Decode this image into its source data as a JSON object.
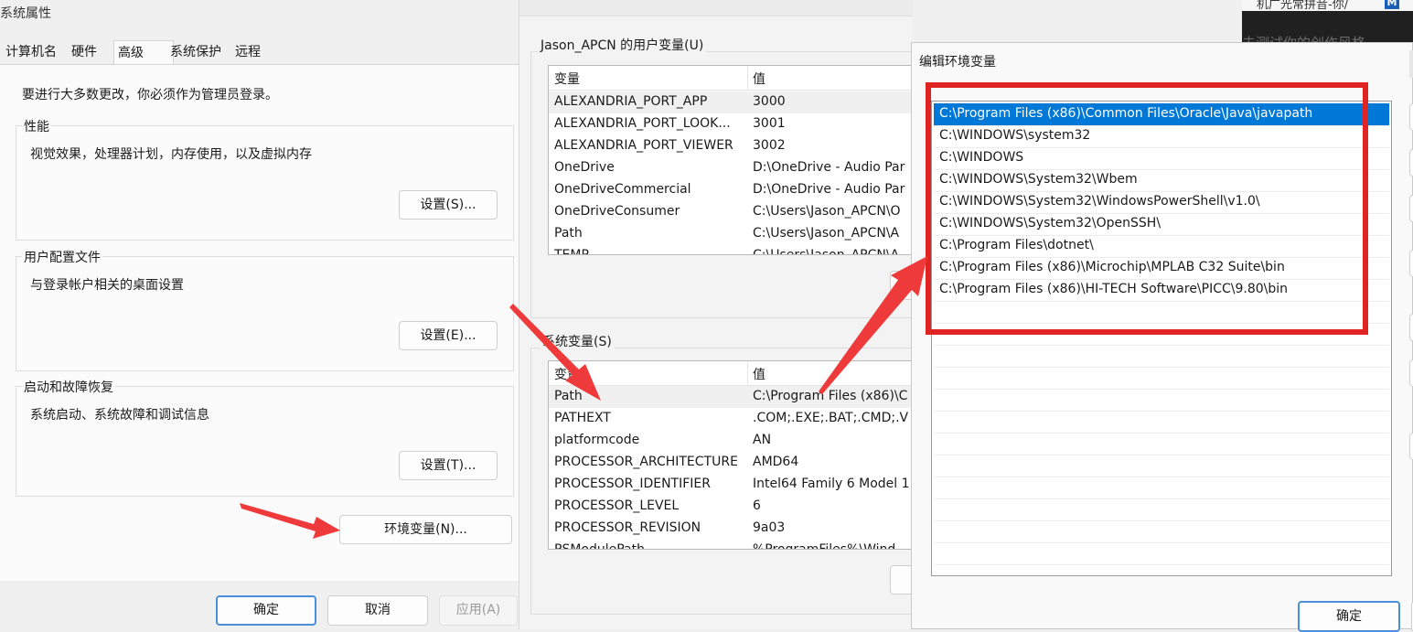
{
  "system_properties": {
    "title": "系统属性",
    "tabs": [
      "计算机名",
      "硬件",
      "高级",
      "系统保护",
      "远程"
    ],
    "admin_note": "要进行大多数更改，你必须作为管理员登录。",
    "performance": {
      "title": "性能",
      "desc": "视觉效果，处理器计划，内存使用，以及虚拟内存",
      "button": "设置(S)..."
    },
    "user_profiles": {
      "title": "用户配置文件",
      "desc": "与登录帐户相关的桌面设置",
      "button": "设置(E)..."
    },
    "startup_recovery": {
      "title": "启动和故障恢复",
      "desc": "系统启动、系统故障和调试信息",
      "button": "设置(T)..."
    },
    "env_button": "环境变量(N)...",
    "ok": "确定",
    "cancel": "取消",
    "apply": "应用(A)"
  },
  "environment_variables": {
    "user_vars_title": "Jason_APCN 的用户变量(U)",
    "columns": [
      "变量",
      "值"
    ],
    "user_vars": [
      {
        "name": "ALEXANDRIA_PORT_APP",
        "value": "3000"
      },
      {
        "name": "ALEXANDRIA_PORT_LOOK...",
        "value": "3001"
      },
      {
        "name": "ALEXANDRIA_PORT_VIEWER",
        "value": "3002"
      },
      {
        "name": "OneDrive",
        "value": "D:\\OneDrive - Audio Par"
      },
      {
        "name": "OneDriveCommercial",
        "value": "D:\\OneDrive - Audio Par"
      },
      {
        "name": "OneDriveConsumer",
        "value": "C:\\Users\\Jason_APCN\\O"
      },
      {
        "name": "Path",
        "value": "C:\\Users\\Jason_APCN\\A"
      },
      {
        "name": "TEMP",
        "value": "C:\\Users\\Jason_APCN\\A"
      }
    ],
    "system_vars_title": "系统变量(S)",
    "system_vars": [
      {
        "name": "Path",
        "value": "C:\\Program Files (x86)\\C"
      },
      {
        "name": "PATHEXT",
        "value": ".COM;.EXE;.BAT;.CMD;.V"
      },
      {
        "name": "platformcode",
        "value": "AN"
      },
      {
        "name": "PROCESSOR_ARCHITECTURE",
        "value": "AMD64"
      },
      {
        "name": "PROCESSOR_IDENTIFIER",
        "value": "Intel64 Family 6 Model 1"
      },
      {
        "name": "PROCESSOR_LEVEL",
        "value": "6"
      },
      {
        "name": "PROCESSOR_REVISION",
        "value": "9a03"
      },
      {
        "name": "PSModulePath",
        "value": "%ProgramFiles%\\Wind"
      }
    ]
  },
  "edit_env": {
    "title": "编辑环境变量",
    "paths": [
      "C:\\Program Files (x86)\\Common Files\\Oracle\\Java\\javapath",
      "C:\\WINDOWS\\system32",
      "C:\\WINDOWS",
      "C:\\WINDOWS\\System32\\Wbem",
      "C:\\WINDOWS\\System32\\WindowsPowerShell\\v1.0\\",
      "C:\\WINDOWS\\System32\\OpenSSH\\",
      "C:\\Program Files\\dotnet\\",
      "C:\\Program Files (x86)\\Microchip\\MPLAB C32 Suite\\bin",
      "C:\\Program Files (x86)\\HI-TECH Software\\PICC\\9.80\\bin"
    ],
    "ok": "确定"
  },
  "background": {
    "snippet": "机广光常拼音-你/",
    "snippet2": "未测试你的创作风格"
  },
  "colors": {
    "annotation_red": "#e02424",
    "selection_blue": "#0078d7"
  }
}
